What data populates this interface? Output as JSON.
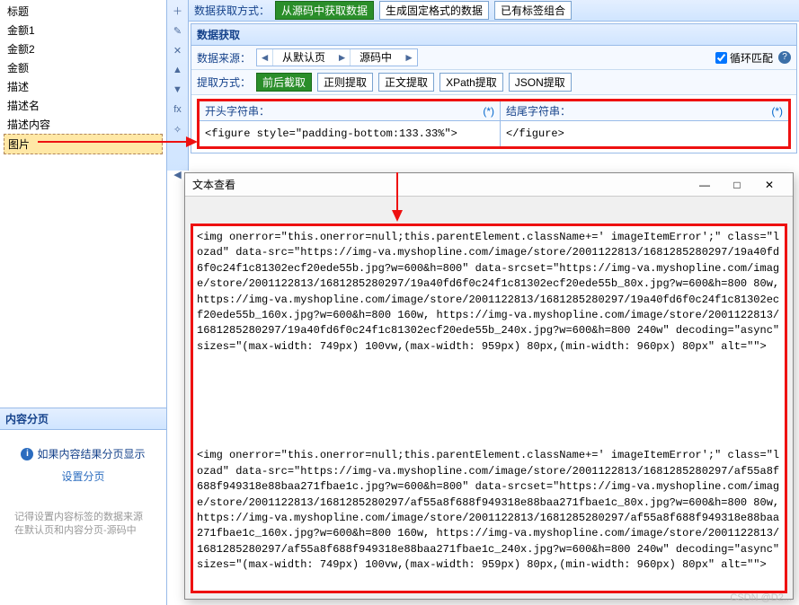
{
  "sidebar": {
    "items": [
      {
        "label": "标题"
      },
      {
        "label": "金额1"
      },
      {
        "label": "金额2"
      },
      {
        "label": "金额"
      },
      {
        "label": "描述"
      },
      {
        "label": "描述名"
      },
      {
        "label": "描述内容"
      },
      {
        "label": "图片"
      }
    ],
    "paging": {
      "title": "内容分页",
      "info": "如果内容结果分页显示",
      "link": "设置分页",
      "hint": "记得设置内容标签的数据来源\n在默认页和内容分页-源码中"
    }
  },
  "toolbar": {
    "icons": [
      "plus-icon",
      "pencil-icon",
      "x-icon",
      "up-icon",
      "down-icon",
      "fx-icon",
      "wand-icon",
      "collapse-icon"
    ]
  },
  "main": {
    "extract_mode_label": "数据获取方式：",
    "modes": [
      "从源码中获取数据",
      "生成固定格式的数据",
      "已有标签组合"
    ],
    "sub_title": "数据获取",
    "source_label": "数据来源：",
    "nav_from": "从默认页",
    "nav_src": "源码中",
    "loop_label": "循环匹配",
    "extract_method_label": "提取方式：",
    "methods": [
      "前后截取",
      "正则提取",
      "正文提取",
      "XPath提取",
      "JSON提取"
    ],
    "start_label": "开头字符串：",
    "end_label": "结尾字符串：",
    "start_val": "<figure style=\"padding-bottom:133.33%\">",
    "end_val": "</figure>",
    "star": "(*)"
  },
  "viewer": {
    "title": "文本查看",
    "minimize": "—",
    "maximize": "□",
    "close": "✕",
    "content": "<img onerror=\"this.onerror=null;this.parentElement.className+=' imageItemError';\" class=\"lozad\" data-src=\"https://img-va.myshopline.com/image/store/2001122813/1681285280297/19a40fd6f0c24f1c81302ecf20ede55b.jpg?w=600&h=800\" data-srcset=\"https://img-va.myshopline.com/image/store/2001122813/1681285280297/19a40fd6f0c24f1c81302ecf20ede55b_80x.jpg?w=600&h=800 80w, https://img-va.myshopline.com/image/store/2001122813/1681285280297/19a40fd6f0c24f1c81302ecf20ede55b_160x.jpg?w=600&h=800 160w, https://img-va.myshopline.com/image/store/2001122813/1681285280297/19a40fd6f0c24f1c81302ecf20ede55b_240x.jpg?w=600&h=800 240w\" decoding=\"async\" sizes=\"(max-width: 749px) 100vw,(max-width: 959px) 80px,(min-width: 960px) 80px\" alt=\"\">\n\n\n\n\n\n\n<img onerror=\"this.onerror=null;this.parentElement.className+=' imageItemError';\" class=\"lozad\" data-src=\"https://img-va.myshopline.com/image/store/2001122813/1681285280297/af55a8f688f949318e88baa271fbae1c.jpg?w=600&h=800\" data-srcset=\"https://img-va.myshopline.com/image/store/2001122813/1681285280297/af55a8f688f949318e88baa271fbae1c_80x.jpg?w=600&h=800 80w, https://img-va.myshopline.com/image/store/2001122813/1681285280297/af55a8f688f949318e88baa271fbae1c_160x.jpg?w=600&h=800 160w, https://img-va.myshopline.com/image/store/2001122813/1681285280297/af55a8f688f949318e88baa271fbae1c_240x.jpg?w=600&h=800 240w\" decoding=\"async\" sizes=\"(max-width: 749px) 100vw,(max-width: 959px) 80px,(min-width: 960px) 80px\" alt=\"\">"
  },
  "watermark": "CSDN @D2..."
}
